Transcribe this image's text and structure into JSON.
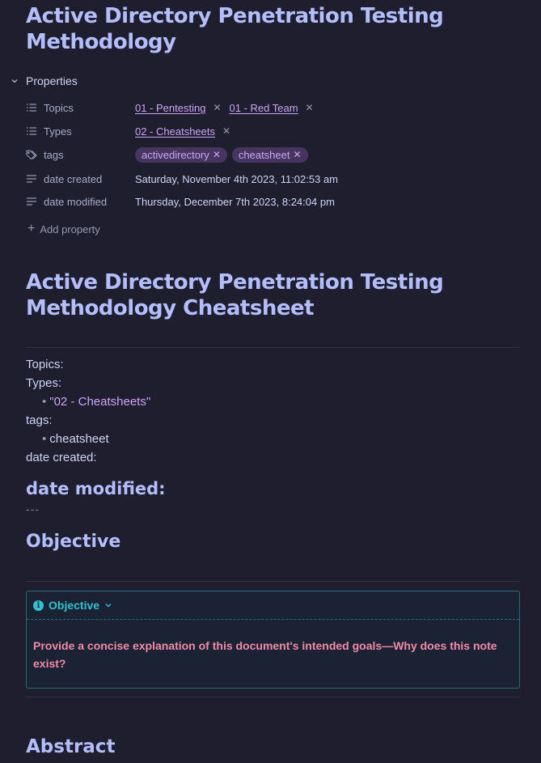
{
  "note": {
    "title": "Active Directory Penetration Testing Methodology"
  },
  "properties": {
    "header": "Properties",
    "rows": [
      {
        "key": "Topics",
        "icon": "list-icon",
        "links": [
          "01 - Pentesting",
          "01 - Red Team"
        ]
      },
      {
        "key": "Types",
        "icon": "list-icon",
        "links": [
          "02 - Cheatsheets"
        ]
      },
      {
        "key": "tags",
        "icon": "tags-icon",
        "tags": [
          "activedirectory",
          "cheatsheet"
        ]
      },
      {
        "key": "date created",
        "icon": "text-icon",
        "value": "Saturday, November 4th 2023, 11:02:53 am"
      },
      {
        "key": "date modified",
        "icon": "text-icon",
        "value": "Thursday, December 7th 2023, 8:24:04 pm"
      }
    ],
    "add_label": "Add property"
  },
  "content": {
    "heading": "Active Directory Penetration Testing Methodology Cheatsheet",
    "topics_label": "Topics:",
    "types_label": "Types:",
    "types_item": "\"02 - Cheatsheets\"",
    "tags_label": "tags:",
    "tags_item": "cheatsheet",
    "date_created_label": "date created:",
    "date_modified_heading": "date modified:",
    "dashes": "---",
    "objective_heading": "Objective",
    "callout": {
      "title": "Objective",
      "body": "Provide a concise explanation of this document's intended goals—Why does this note exist?"
    },
    "abstract_heading": "Abstract"
  },
  "colors": {
    "background": "#1e1e2e",
    "heading": "#b4befe",
    "link": "#cba6f7",
    "callout_accent": "#2ec4d6",
    "callout_text": "#f38ba8"
  }
}
